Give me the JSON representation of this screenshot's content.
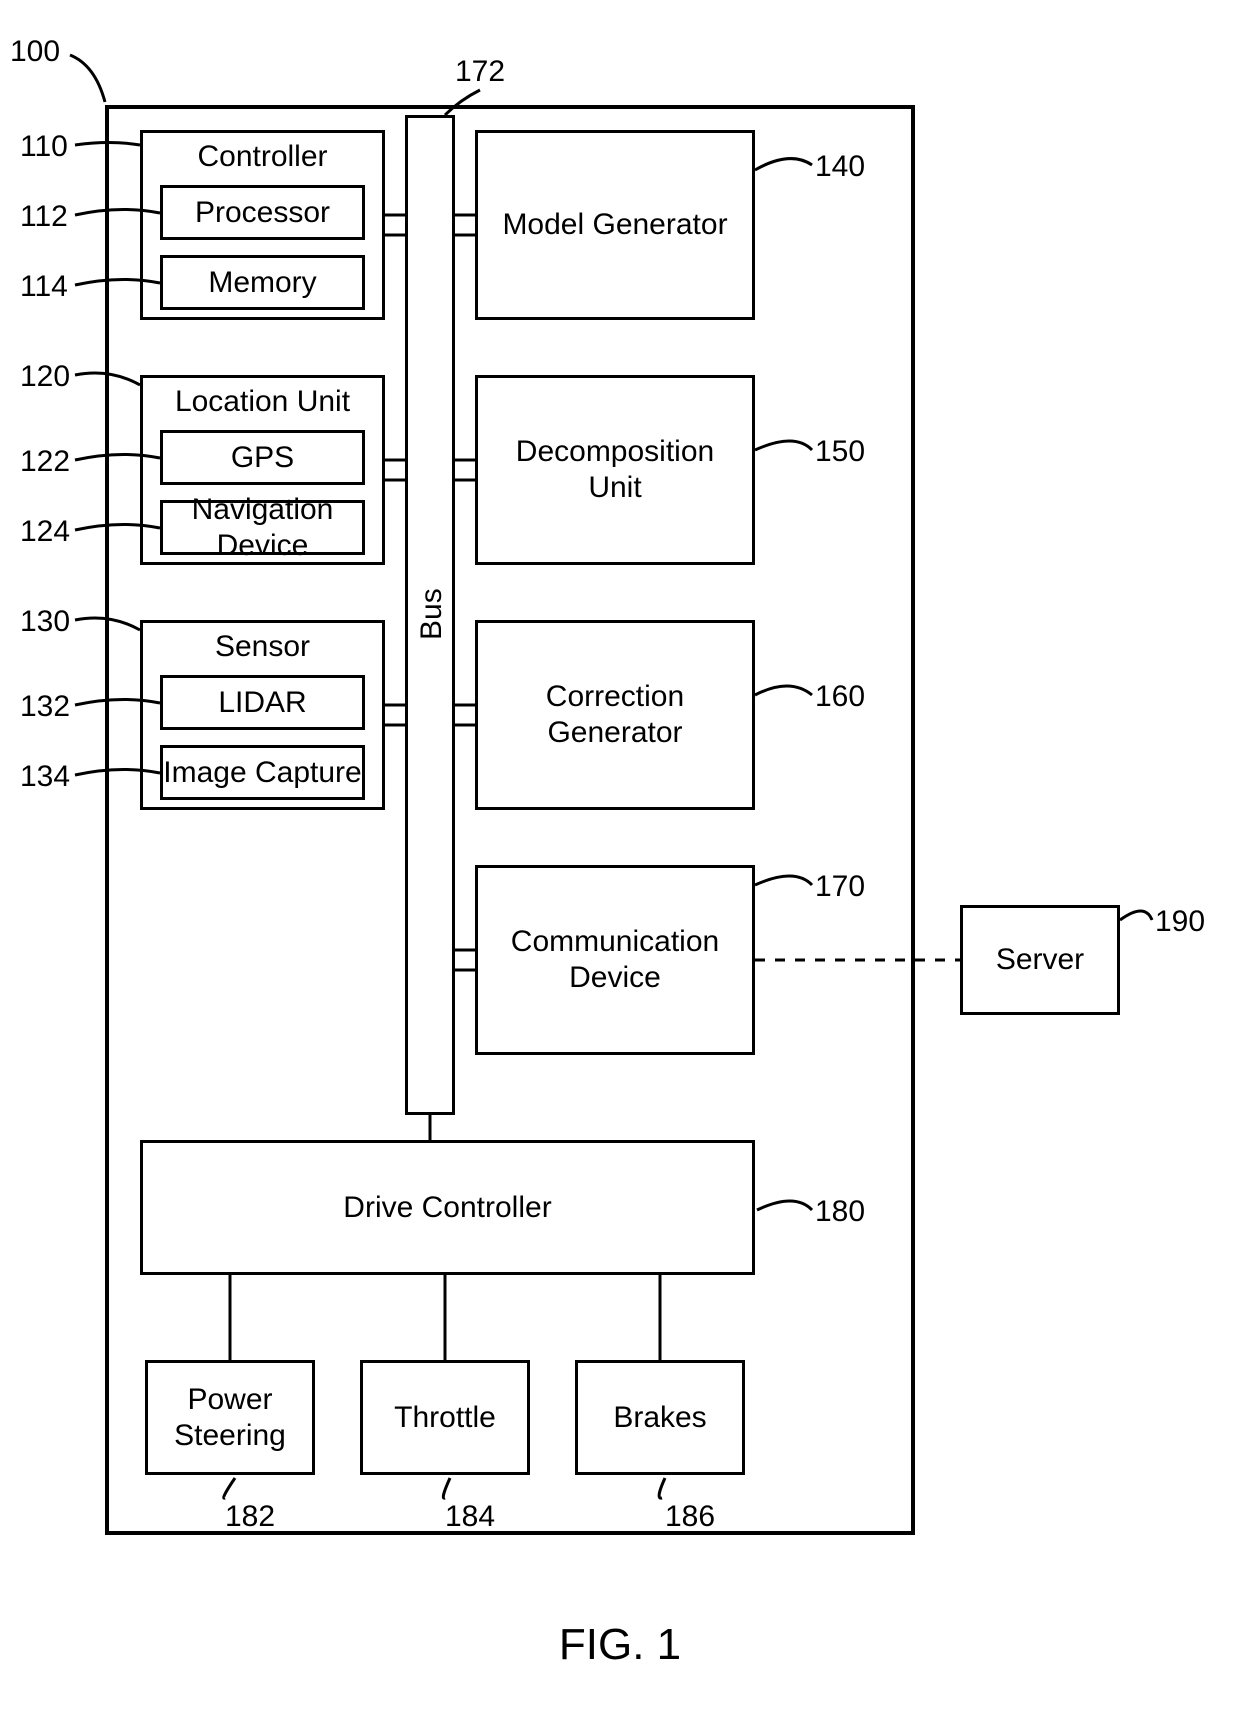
{
  "figure_label": "FIG. 1",
  "refs": {
    "r100": "100",
    "r110": "110",
    "r112": "112",
    "r114": "114",
    "r120": "120",
    "r122": "122",
    "r124": "124",
    "r130": "130",
    "r132": "132",
    "r134": "134",
    "r140": "140",
    "r150": "150",
    "r160": "160",
    "r170": "170",
    "r172": "172",
    "r180": "180",
    "r182": "182",
    "r184": "184",
    "r186": "186",
    "r190": "190"
  },
  "blocks": {
    "controller": "Controller",
    "processor": "Processor",
    "memory": "Memory",
    "location_unit": "Location Unit",
    "gps": "GPS",
    "navigation": "Navigation Device",
    "sensor": "Sensor",
    "lidar": "LIDAR",
    "image_capture": "Image Capture",
    "model_generator": "Model Generator",
    "decomposition_unit": "Decomposition\nUnit",
    "correction_generator": "Correction\nGenerator",
    "communication_device": "Communication\nDevice",
    "bus": "Bus",
    "drive_controller": "Drive Controller",
    "power_steering": "Power\nSteering",
    "throttle": "Throttle",
    "brakes": "Brakes",
    "server": "Server"
  }
}
